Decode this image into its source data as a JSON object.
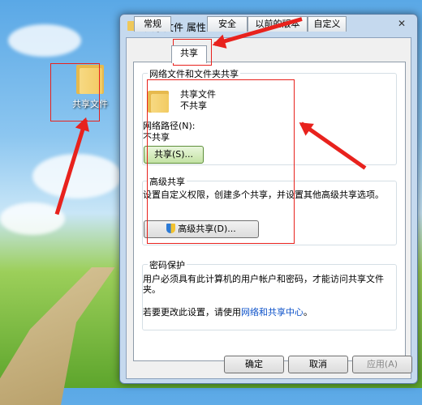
{
  "desktop": {
    "folder_label": "共享文件"
  },
  "dialog": {
    "title": "共享文件 属性",
    "close_glyph": "✕",
    "tabs": [
      "常规",
      "共享",
      "安全",
      "以前的版本",
      "自定义"
    ],
    "network_section": {
      "heading": "网络文件和文件夹共享",
      "folder_name": "共享文件",
      "folder_status": "不共享",
      "path_label": "网络路径(N):",
      "path_value": "不共享",
      "share_button": "共享(S)..."
    },
    "advanced_section": {
      "heading": "高级共享",
      "description": "设置自定义权限，创建多个共享，并设置其他高级共享选项。",
      "button": "高级共享(D)..."
    },
    "password_section": {
      "heading": "密码保护",
      "description": "用户必须具有此计算机的用户帐户和密码，才能访问共享文件夹。",
      "change_prefix": "若要更改此设置，请使用",
      "link": "网络和共享中心",
      "change_suffix": "。"
    },
    "buttons": {
      "ok": "确定",
      "cancel": "取消",
      "apply": "应用(A)"
    }
  },
  "colors": {
    "annotation_red": "#e8221d",
    "link": "#0b50c8"
  }
}
